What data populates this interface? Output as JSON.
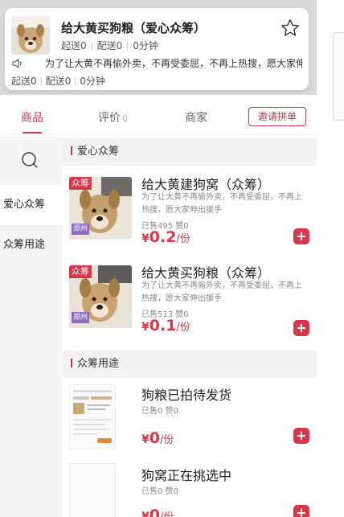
{
  "store": {
    "name": "给大黄买狗粮（爱心众筹）",
    "stats": [
      "起送0",
      "配送0",
      "0分钟"
    ],
    "notice": "为了让大黄不再偷外卖，不再受委屈，不再上热搜，愿大家伸出援手",
    "stats_bottom": [
      "起送0",
      "配送0",
      "0分钟"
    ]
  },
  "tabs": {
    "goods": "商品",
    "review": "评价",
    "review_count": "0",
    "merchant": "商家",
    "invite": "邀请拼单"
  },
  "sidebar": {
    "categories": [
      "爱心众筹",
      "众筹用途"
    ]
  },
  "sections": [
    {
      "title": "爱心众筹",
      "products": [
        {
          "title": "给大黄建狗窝（众筹）",
          "desc": "为了让大黄不再偷外卖，不再受委屈，不再上热搜，愿大家伸出援手",
          "stats": "已售495 赞0",
          "currency": "¥",
          "price": "0.2",
          "unit": "/份",
          "badge": "众筹",
          "loc": "郑州"
        },
        {
          "title": "给大黄买狗粮（众筹）",
          "desc": "为了让大黄不再偷外卖，不再受委屈，不再上热搜，愿大家伸出援手",
          "stats": "已售513 赞0",
          "currency": "¥",
          "price": "0.1",
          "unit": "/份",
          "badge": "众筹",
          "loc": "郑州"
        }
      ]
    },
    {
      "title": "众筹用途",
      "products": [
        {
          "title": "狗粮已拍待发货",
          "stats": "已售0 赞0",
          "currency": "¥",
          "price": "0",
          "unit": "/份"
        },
        {
          "title": "狗窝正在挑选中",
          "stats": "已售0 赞0",
          "currency": "¥",
          "price": "0",
          "unit": "/份"
        }
      ]
    }
  ],
  "colors": {
    "accent": "#d8364b",
    "tab_active": "#c0374b",
    "sidebar_bg": "#f5f5f5"
  },
  "icons": [
    "star-icon",
    "speaker-icon",
    "search-icon",
    "plus-icon",
    "dog-photo"
  ]
}
